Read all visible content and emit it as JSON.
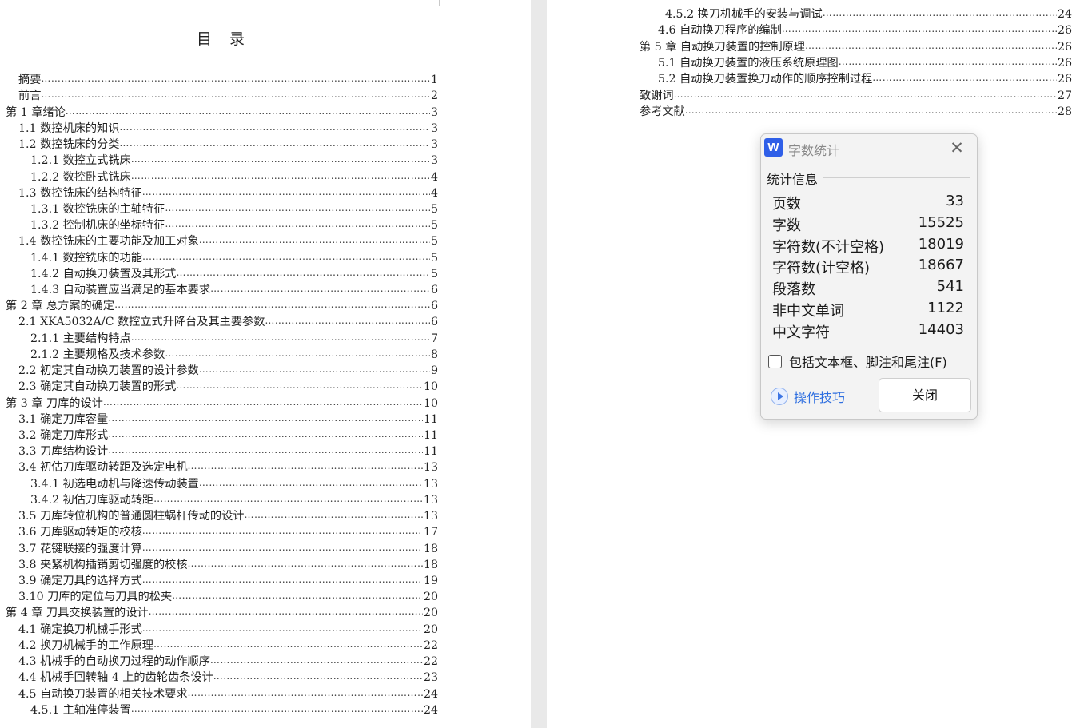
{
  "toc_title": "目 录",
  "left_entries": [
    {
      "text": "摘要",
      "page": "1"
    },
    {
      "text": "前言",
      "page": "2"
    },
    {
      "text": "第 1 章绪论",
      "page": "3"
    },
    {
      "text": "1.1 数控机床的知识",
      "page": "3"
    },
    {
      "text": "1.2  数控铣床的分类",
      "page": "3"
    },
    {
      "text": "1.2.1  数控立式铣床",
      "page": "3"
    },
    {
      "text": "1.2.2  数控卧式铣床",
      "page": "4"
    },
    {
      "text": "1.3  数控铣床的结构特征",
      "page": "4"
    },
    {
      "text": "1.3.1  数控铣床的主轴特征",
      "page": "5"
    },
    {
      "text": "1.3.2  控制机床的坐标特征",
      "page": "5"
    },
    {
      "text": "1.4  数控铣床的主要功能及加工对象",
      "page": "5"
    },
    {
      "text": "1.4.1  数控铣床的功能",
      "page": "5"
    },
    {
      "text": "1.4.2  自动换刀装置及其形式",
      "page": "5"
    },
    {
      "text": "1.4.3  自动装置应当满足的基本要求",
      "page": "6"
    },
    {
      "text": "第 2 章  总方案的确定",
      "page": "6"
    },
    {
      "text": "2.1  XKA5032A/C 数控立式升降台及其主要参数",
      "page": "6"
    },
    {
      "text": "2.1.1  主要结构特点",
      "page": "7"
    },
    {
      "text": "2.1.2  主要规格及技术参数",
      "page": "8"
    },
    {
      "text": "2.2  初定其自动换刀装置的设计参数",
      "page": "9"
    },
    {
      "text": "2.3  确定其自动换刀装置的形式",
      "page": "10"
    },
    {
      "text": "第 3 章  刀库的设计",
      "page": "10"
    },
    {
      "text": "3.1  确定刀库容量",
      "page": "11"
    },
    {
      "text": "3.2  确定刀库形式",
      "page": "11"
    },
    {
      "text": "3.3  刀库结构设计",
      "page": "11"
    },
    {
      "text": "3.4  初估刀库驱动转距及选定电机",
      "page": "13"
    },
    {
      "text": "3.4.1 初选电动机与降速传动装置",
      "page": "13"
    },
    {
      "text": "3.4.2 初估刀库驱动转距",
      "page": "13"
    },
    {
      "text": "3.5 刀库转位机构的普通圆柱蜗杆传动的设计",
      "page": "13"
    },
    {
      "text": "3.6 刀库驱动转矩的校核",
      "page": "17"
    },
    {
      "text": "3.7 花键联接的强度计算",
      "page": "18"
    },
    {
      "text": "3.8 夹紧机构插销剪切强度的校核",
      "page": "18"
    },
    {
      "text": "3.9 确定刀具的选择方式",
      "page": "19"
    },
    {
      "text": "3.10 刀库的定位与刀具的松夹",
      "page": "20"
    },
    {
      "text": "第 4 章  刀具交换装置的设计",
      "page": "20"
    },
    {
      "text": "4.1 确定换刀机械手形式",
      "page": "20"
    },
    {
      "text": "4.2 换刀机械手的工作原理",
      "page": "22"
    },
    {
      "text": "4.3 机械手的自动换刀过程的动作顺序",
      "page": "22"
    },
    {
      "text": "4.4 机械手回转轴 4 上的齿轮齿条设计",
      "page": "23"
    },
    {
      "text": "4.5 自动换刀装置的相关技术要求",
      "page": "24"
    },
    {
      "text": "4.5.1 主轴准停装置",
      "page": "24"
    }
  ],
  "right_entries": [
    {
      "text": "4.5.2 换刀机械手的安装与调试",
      "page": "24"
    },
    {
      "text": "4.6 自动换刀程序的编制",
      "page": "26"
    },
    {
      "text": "第 5 章  自动换刀装置的控制原理",
      "page": "26"
    },
    {
      "text": "5.1 自动换刀装置的液压系统原理图",
      "page": "26"
    },
    {
      "text": "5.2 自动换刀装置换刀动作的顺序控制过程",
      "page": "26"
    },
    {
      "text": "致谢词",
      "page": "27"
    },
    {
      "text": "参考文献",
      "page": "28"
    }
  ],
  "dialog": {
    "logo": "W",
    "title": "字数统计",
    "section": "统计信息",
    "stats": [
      {
        "label": "页数",
        "value": "33"
      },
      {
        "label": "字数",
        "value": "15525"
      },
      {
        "label": "字符数(不计空格)",
        "value": "18019"
      },
      {
        "label": "字符数(计空格)",
        "value": "18667"
      },
      {
        "label": "段落数",
        "value": "541"
      },
      {
        "label": "非中文单词",
        "value": "1122"
      },
      {
        "label": "中文字符",
        "value": "14403"
      }
    ],
    "checkbox_label": "包括文本框、脚注和尾注(F)",
    "tips_label": "操作技巧",
    "close_label": "关闭",
    "close_glyph": "✕"
  }
}
